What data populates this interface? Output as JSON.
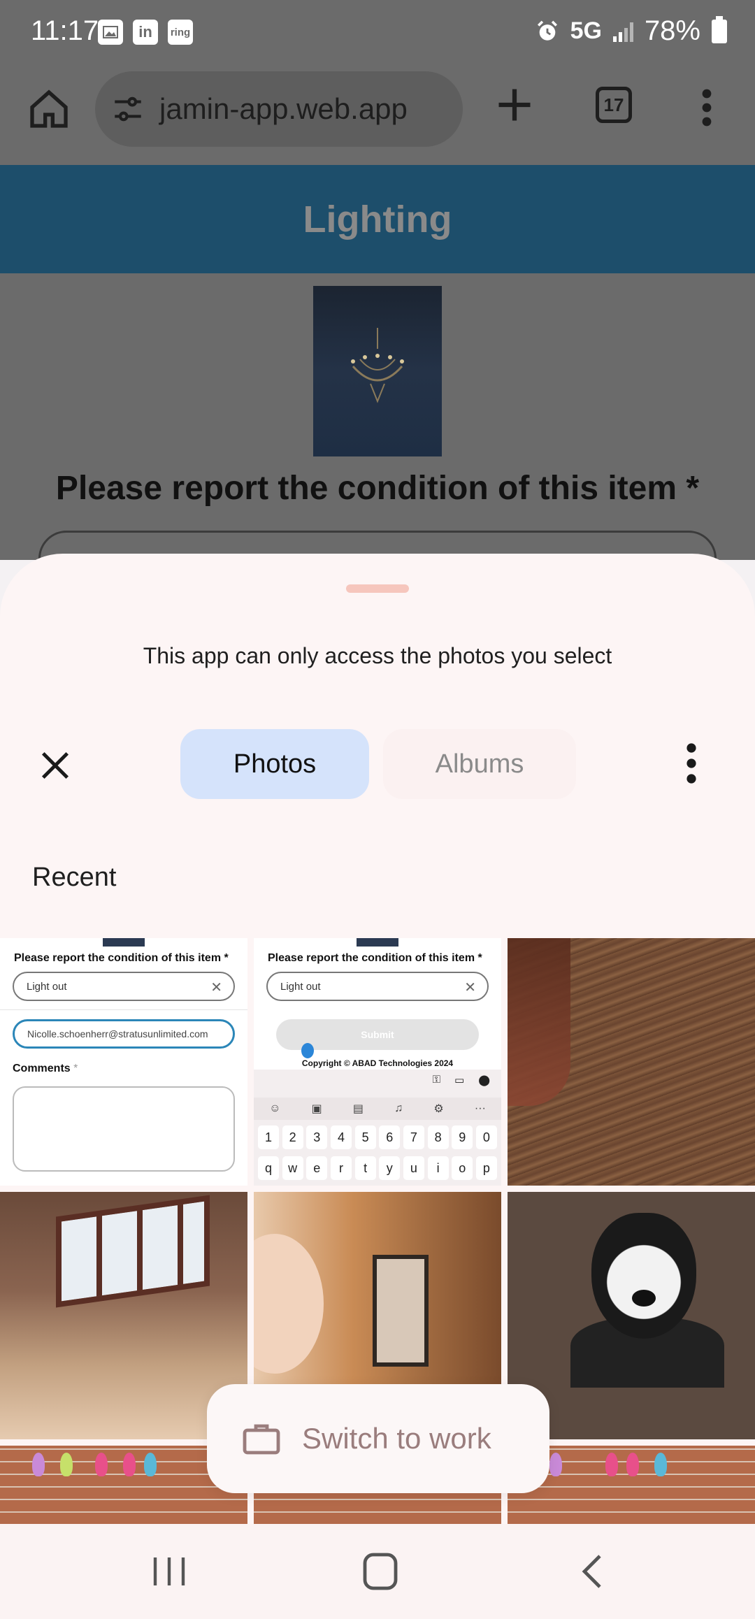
{
  "status_bar": {
    "time": "11:17",
    "notifications": [
      "gallery-icon",
      "linkedin-icon",
      "ring-icon"
    ],
    "linkedin_text": "in",
    "ring_text": "ring",
    "network": "5G",
    "battery": "78%"
  },
  "browser": {
    "url": "jamin-app.web.app",
    "tab_count": "17"
  },
  "page": {
    "header_title": "Lighting",
    "question": "Please report the condition of this item *"
  },
  "picker": {
    "notice": "This app can only access the photos you select",
    "tabs": [
      {
        "label": "Photos",
        "selected": true
      },
      {
        "label": "Albums",
        "selected": false
      }
    ],
    "section_label": "Recent",
    "switch_profile_label": "Switch to work"
  },
  "thumbnails": {
    "shot1": {
      "question": "Please report the condition of this item *",
      "condition_value": "Light out",
      "email_value": "Nicolle.schoenherr@stratusunlimited.com",
      "comments_label": "Comments",
      "required_mark": "*"
    },
    "shot2": {
      "question": "Please report the condition of this item *",
      "condition_value": "Light out",
      "submit_label": "Submit",
      "copyright": "Copyright © ABAD Technologies 2024",
      "keyboard_row_numbers": [
        "1",
        "2",
        "3",
        "4",
        "5",
        "6",
        "7",
        "8",
        "9",
        "0"
      ],
      "keyboard_row_letters": [
        "q",
        "w",
        "e",
        "r",
        "t",
        "y",
        "u",
        "i",
        "o",
        "p"
      ]
    }
  },
  "colors": {
    "selected_tab": "#d5e3fb",
    "sheet_background": "#fdf5f5",
    "page_header": "#1d4e6b"
  }
}
